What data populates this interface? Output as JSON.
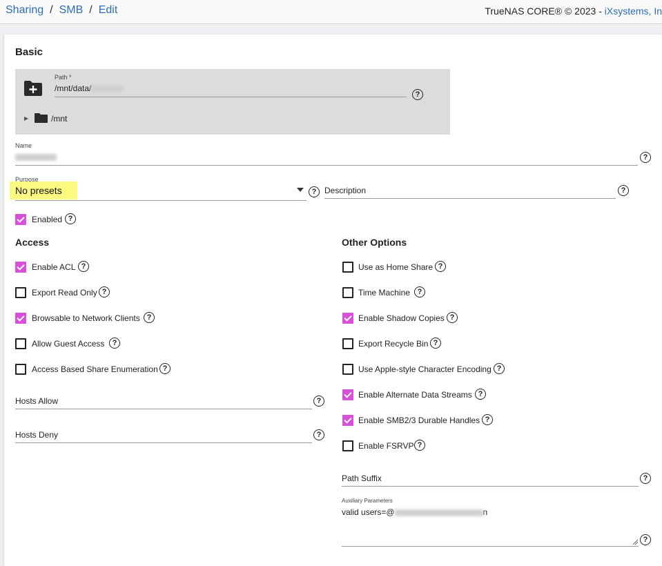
{
  "breadcrumb": [
    "Sharing",
    "SMB",
    "Edit"
  ],
  "copyright": {
    "text": "TrueNAS CORE® © 2023 - ",
    "company": "iXsystems, In"
  },
  "basic": {
    "title": "Basic",
    "path": {
      "label": "Path *",
      "value": "/mnt/data/",
      "tree_root": "/mnt"
    },
    "name": {
      "label": "Name"
    },
    "purpose": {
      "label": "Purpose",
      "value": "No presets"
    },
    "description": {
      "placeholder": "Description"
    },
    "enabled": {
      "label": "Enabled",
      "checked": true
    }
  },
  "access": {
    "title": "Access",
    "options": [
      {
        "label": "Enable ACL",
        "checked": true
      },
      {
        "label": "Export Read Only",
        "checked": false
      },
      {
        "label": "Browsable to Network Clients",
        "checked": true
      },
      {
        "label": "Allow Guest Access",
        "checked": false
      },
      {
        "label": "Access Based Share Enumeration",
        "checked": false
      }
    ],
    "hosts_allow": "Hosts Allow",
    "hosts_deny": "Hosts Deny"
  },
  "other": {
    "title": "Other Options",
    "options": [
      {
        "label": "Use as Home Share",
        "checked": false
      },
      {
        "label": "Time Machine",
        "checked": false
      },
      {
        "label": "Enable Shadow Copies",
        "checked": true
      },
      {
        "label": "Export Recycle Bin",
        "checked": false
      },
      {
        "label": "Use Apple-style Character Encoding",
        "checked": false
      },
      {
        "label": "Enable Alternate Data Streams",
        "checked": true
      },
      {
        "label": "Enable SMB2/3 Durable Handles",
        "checked": true
      },
      {
        "label": "Enable FSRVP",
        "checked": false
      }
    ],
    "path_suffix": "Path Suffix",
    "aux": {
      "label": "Auxiliary Parameters",
      "value_prefix": "valid users=@",
      "value_suffix": "n"
    }
  },
  "colors": {
    "link": "#2b6cb5",
    "checkbox_checked": "#d84fd8",
    "highlight": "#fafa80"
  }
}
